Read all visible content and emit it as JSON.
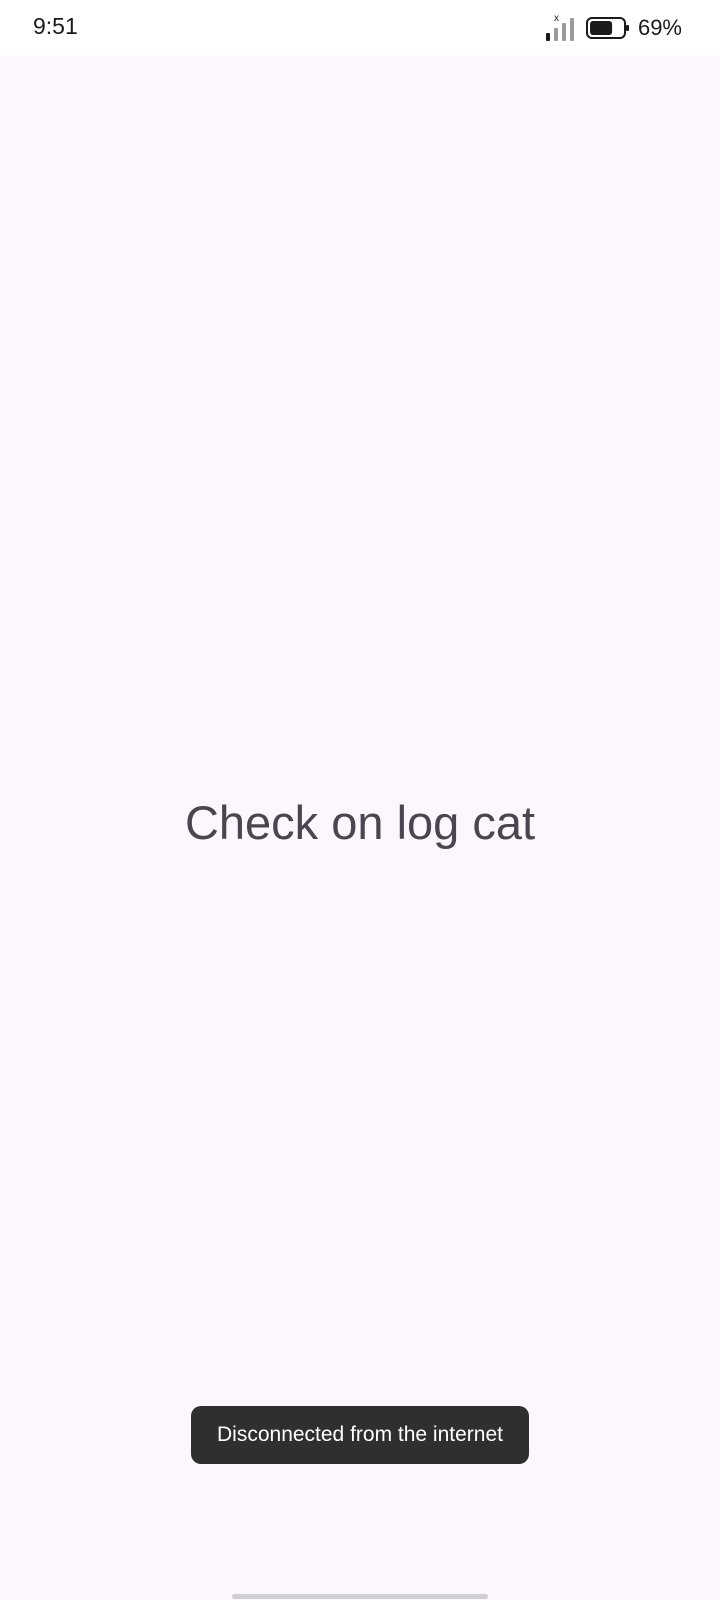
{
  "status_bar": {
    "time": "9:51",
    "battery_percent": "69%",
    "signal_icon": "signal-x-icon",
    "battery_icon": "battery-icon",
    "battery_level": 0.69
  },
  "main": {
    "center_text": "Check on log cat"
  },
  "toast": {
    "message": "Disconnected from the internet"
  },
  "colors": {
    "background": "#fcf6fd",
    "text": "#4a4550",
    "toast_background": "#2f2f2f",
    "toast_text": "#ffffff"
  }
}
